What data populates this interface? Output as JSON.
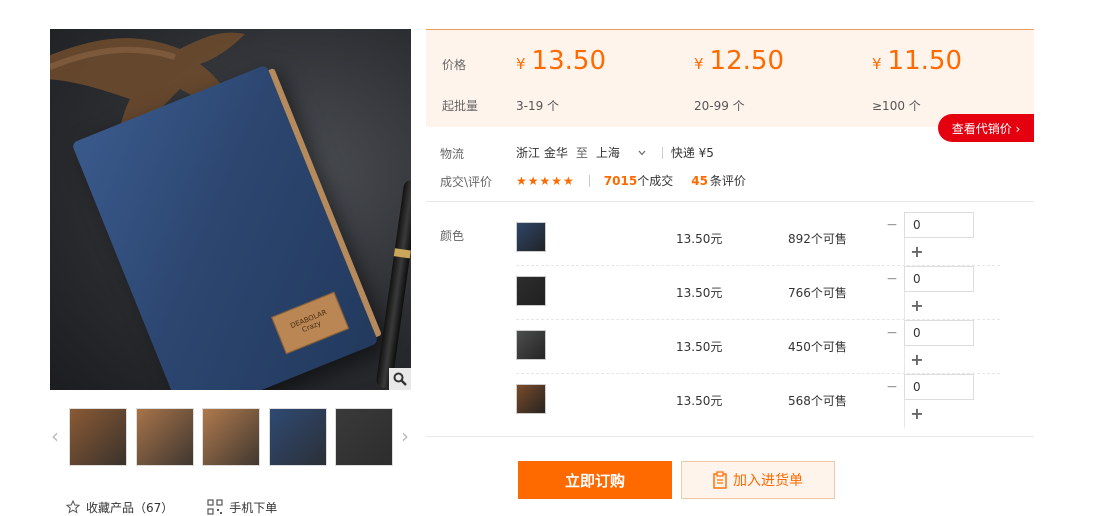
{
  "gallery": {
    "product_tag_text": "DEABOLAR",
    "product_tag_sub": "Crazy",
    "thumbnails": [
      {
        "color": "#8a5a34"
      },
      {
        "color": "#a7744a"
      },
      {
        "color": "#b07a4d"
      },
      {
        "color": "#2f4a73"
      },
      {
        "color": "#3a3a3a"
      }
    ],
    "prev_glyph": "‹",
    "next_glyph": "›",
    "favorite_label": "收藏产品（67）",
    "mobile_order_label": "手机下单"
  },
  "pricing": {
    "price_label": "价格",
    "moq_label": "起批量",
    "currency": "¥",
    "tiers": [
      {
        "price": "13.50",
        "range": "3-19 个"
      },
      {
        "price": "12.50",
        "range": "20-99 个"
      },
      {
        "price": "11.50",
        "range": "≥100 个"
      }
    ],
    "agent_price_button": "查看代销价 ›"
  },
  "logistics": {
    "label": "物流",
    "from": "浙江 金华",
    "to_word": "至",
    "dest": "上海",
    "shipping": "快递 ¥5"
  },
  "deals": {
    "label": "成交\\评价",
    "stars": "★★★★★",
    "deal_count": "7015",
    "deal_suffix": "个成交",
    "review_count": "45",
    "review_suffix": "条评价"
  },
  "sku": {
    "label": "颜色",
    "items": [
      {
        "price": "13.50元",
        "stock": "892个可售",
        "qty": "0",
        "color": "#2e4668"
      },
      {
        "price": "13.50元",
        "stock": "766个可售",
        "qty": "0",
        "color": "#2d2d2d"
      },
      {
        "price": "13.50元",
        "stock": "450个可售",
        "qty": "0",
        "color": "#4d4f4e"
      },
      {
        "price": "13.50元",
        "stock": "568个可售",
        "qty": "0",
        "color": "#7a4b2a"
      }
    ],
    "minus_glyph": "−",
    "plus_glyph": "+"
  },
  "buttons": {
    "buy_now": "立即订购",
    "add_to_cart": "加入进货单"
  },
  "colors": {
    "accent": "#ff6a00",
    "agent_red": "#e4000f"
  }
}
